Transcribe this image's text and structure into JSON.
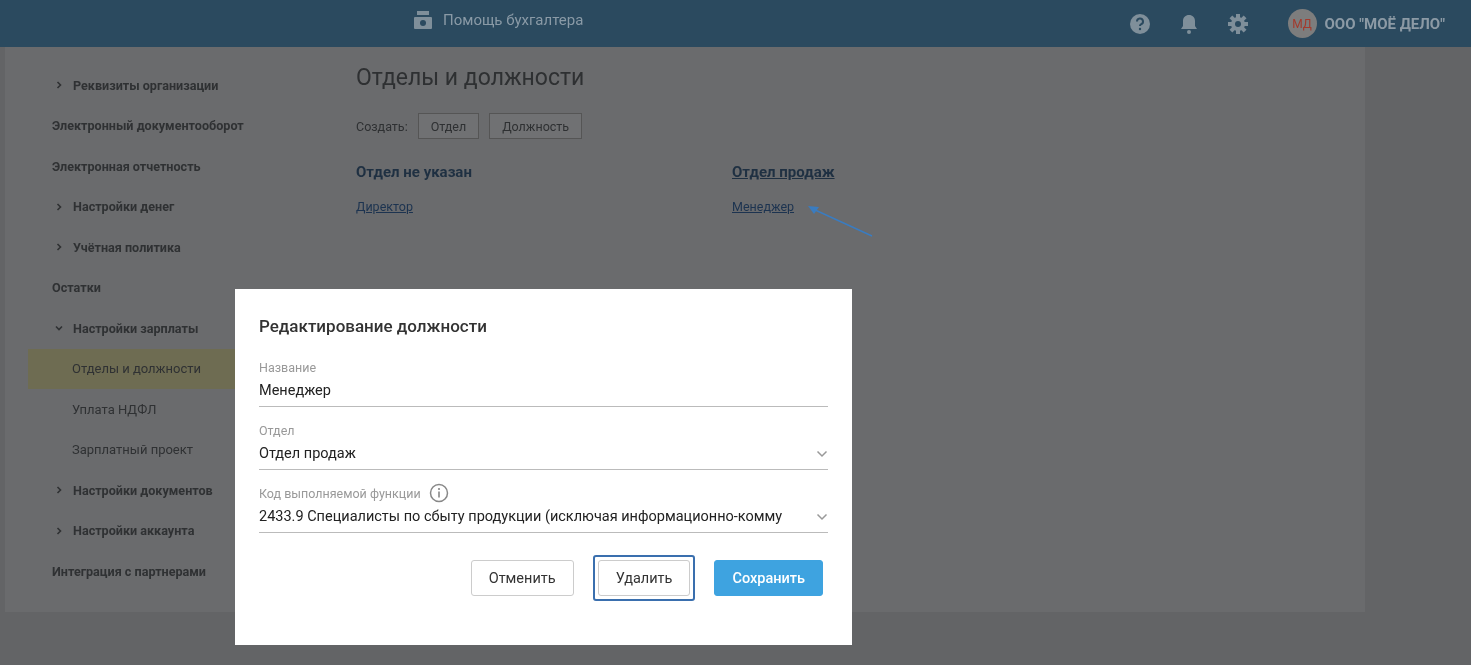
{
  "header": {
    "title": "Помощь бухгалтера",
    "user_initials": "МД",
    "organization": "ООО \"МОЁ ДЕЛО\""
  },
  "sidebar": {
    "items": [
      {
        "label": "Реквизиты организации",
        "kind": "group",
        "expanded": false
      },
      {
        "label": "Электронный документооборот",
        "kind": "link"
      },
      {
        "label": "Электронная отчетность",
        "kind": "link"
      },
      {
        "label": "Настройки денег",
        "kind": "group",
        "expanded": false
      },
      {
        "label": "Учётная политика",
        "kind": "group",
        "expanded": false
      },
      {
        "label": "Остатки",
        "kind": "link"
      },
      {
        "label": "Настройки зарплаты",
        "kind": "group",
        "expanded": true,
        "children": [
          {
            "label": "Отделы и должности",
            "selected": true
          },
          {
            "label": "Уплата НДФЛ",
            "selected": false
          },
          {
            "label": "Зарплатный проект",
            "selected": false
          }
        ]
      },
      {
        "label": "Настройки документов",
        "kind": "group",
        "expanded": false
      },
      {
        "label": "Настройки аккаунта",
        "kind": "group",
        "expanded": false
      },
      {
        "label": "Интеграция с партнерами",
        "kind": "link"
      }
    ]
  },
  "page": {
    "title": "Отделы и должности",
    "create_label": "Создать:",
    "create_buttons": [
      "Отдел",
      "Должность"
    ],
    "departments": [
      {
        "name": "Отдел не указан",
        "link": false,
        "positions": [
          "Директор"
        ]
      },
      {
        "name": "Отдел продаж",
        "link": true,
        "positions": [
          "Менеджер"
        ]
      }
    ]
  },
  "dialog": {
    "title": "Редактирование должности",
    "fields": [
      {
        "label": "Название",
        "value": "Менеджер",
        "kind": "input"
      },
      {
        "label": "Отдел",
        "value": "Отдел продаж",
        "kind": "select"
      },
      {
        "label": "Код выполняемой функции",
        "value": "2433.9 Специалисты по сбыту продукции (исключая информационно-комму",
        "kind": "select",
        "info": true
      }
    ],
    "buttons": [
      {
        "label": "Отменить",
        "kind": "secondary",
        "focused": false
      },
      {
        "label": "Удалить",
        "kind": "secondary",
        "focused": true
      },
      {
        "label": "Сохранить",
        "kind": "primary",
        "focused": false
      }
    ]
  }
}
